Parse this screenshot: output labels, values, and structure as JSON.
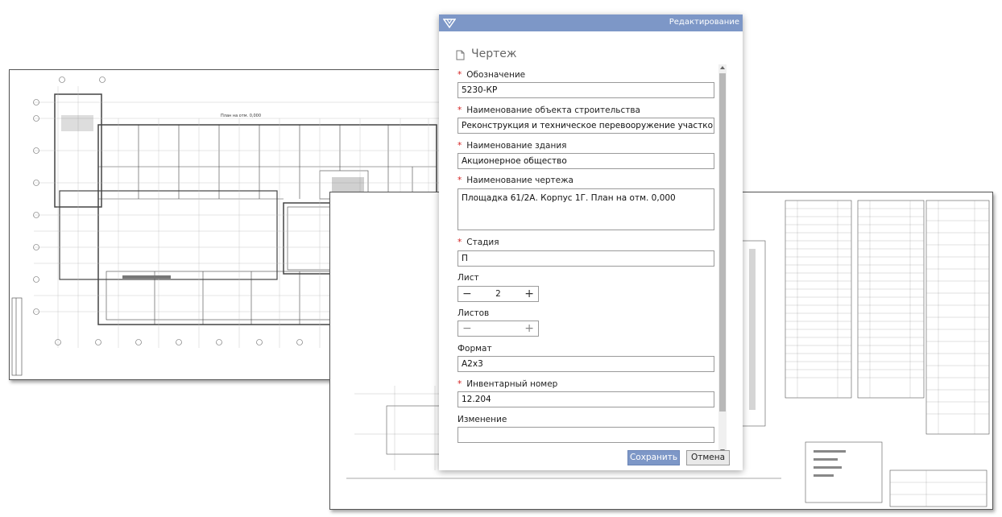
{
  "dialog": {
    "title": "Редактирование",
    "logo_icon": "app-logo-icon",
    "form_title": "Чертеж",
    "form_icon": "document-icon"
  },
  "fields": {
    "designation": {
      "label": "Обозначение",
      "required": true,
      "value": "5230-КР"
    },
    "object_name": {
      "label": "Наименование объекта строительства",
      "required": true,
      "value": "Реконструкция и техническое перевооружение участков электроис"
    },
    "building_name": {
      "label": "Наименование здания",
      "required": true,
      "value": "Акционерное общество"
    },
    "drawing_name": {
      "label": "Наименование чертежа",
      "required": true,
      "value": "Площадка 61/2А. Корпус 1Г. План на отм. 0,000"
    },
    "stage": {
      "label": "Стадия",
      "required": true,
      "value": "П"
    },
    "sheet": {
      "label": "Лист",
      "required": false,
      "value": "2"
    },
    "sheets": {
      "label": "Листов",
      "required": false,
      "value": ""
    },
    "format": {
      "label": "Формат",
      "required": false,
      "value": "А2х3"
    },
    "inventory": {
      "label": "Инвентарный номер",
      "required": true,
      "value": "12.204"
    },
    "change": {
      "label": "Изменение",
      "required": false,
      "value": ""
    }
  },
  "required_marker": "*",
  "stepper": {
    "minus": "−",
    "plus": "+"
  },
  "buttons": {
    "save": "Сохранить",
    "cancel": "Отмена"
  },
  "background": {
    "drawing_a_caption": "План на отм. 0,000"
  },
  "colors": {
    "accent": "#7d97c7",
    "required": "#d42020"
  }
}
